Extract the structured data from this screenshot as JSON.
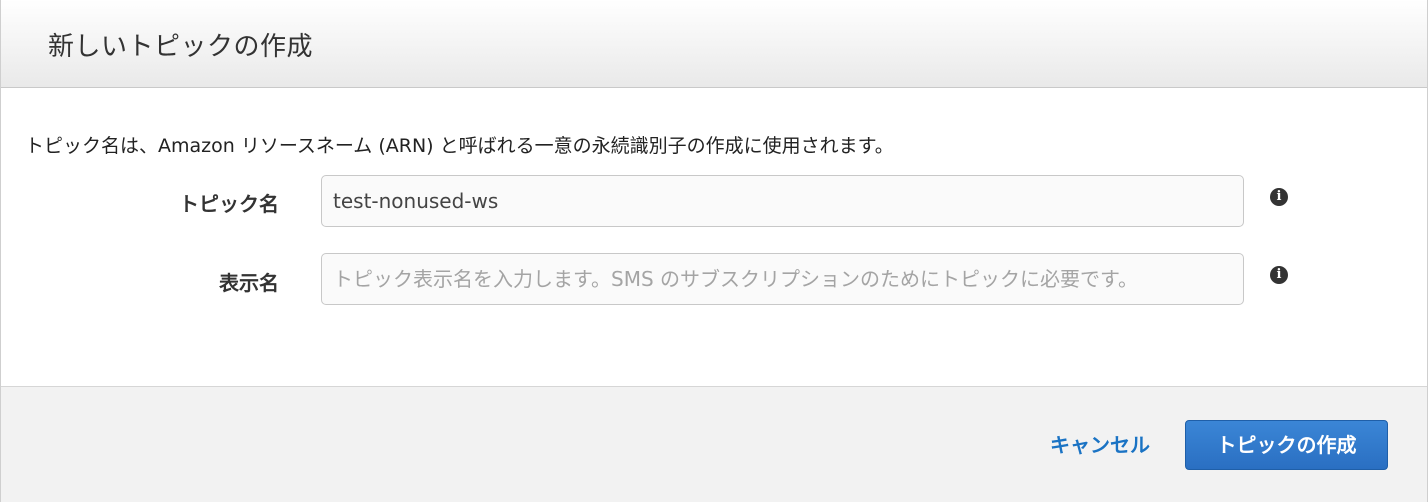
{
  "dialog": {
    "title": "新しいトピックの作成",
    "intro": "トピック名は、Amazon リソースネーム (ARN) と呼ばれる一意の永続識別子の作成に使用されます。"
  },
  "fields": {
    "topic_name": {
      "label": "トピック名",
      "value": "test-nonused-ws"
    },
    "display_name": {
      "label": "表示名",
      "placeholder": "トピック表示名を入力します。SMS のサブスクリプションのためにトピックに必要です。"
    },
    "info_glyph": "i"
  },
  "footer": {
    "cancel_label": "キャンセル",
    "create_label": "トピックの作成"
  },
  "colors": {
    "primary": "#2a6fc2",
    "link": "#1a73c4"
  }
}
